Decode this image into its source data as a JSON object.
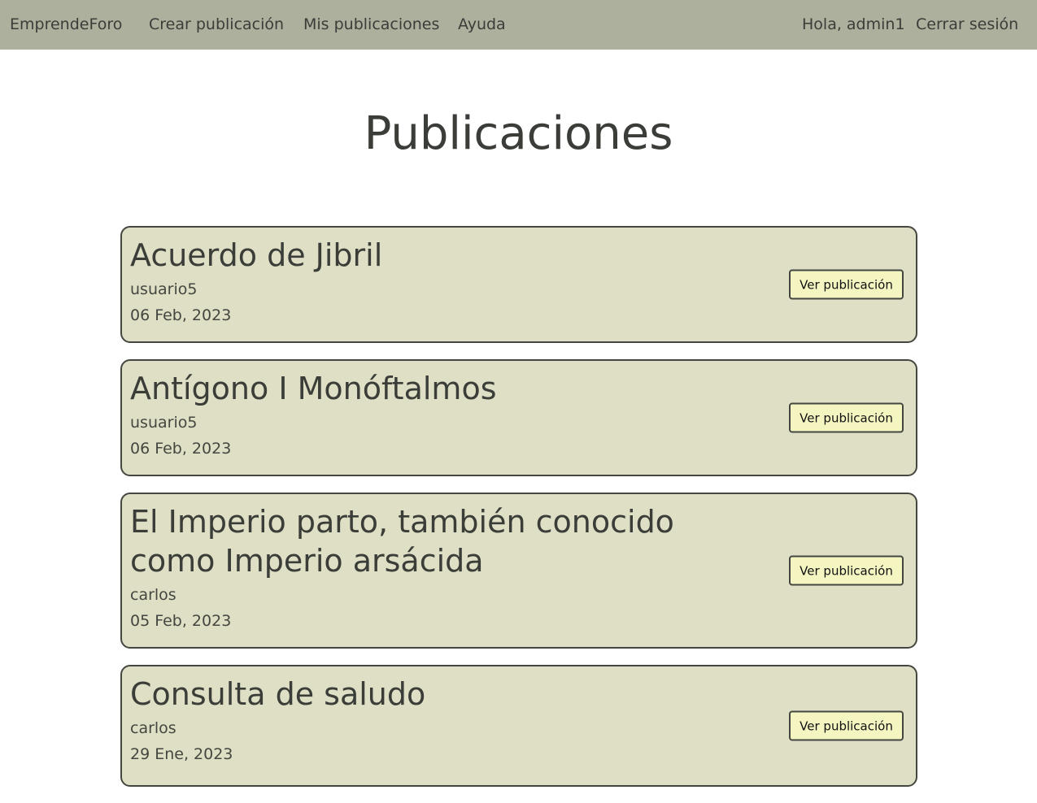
{
  "navbar": {
    "brand": "EmprendeForo",
    "links": [
      "Crear publicación",
      "Mis publicaciones",
      "Ayuda"
    ],
    "greeting": "Hola, admin1",
    "logout": "Cerrar sesión"
  },
  "page": {
    "title": "Publicaciones"
  },
  "posts": [
    {
      "title": "Acuerdo de Jibril",
      "author": "usuario5",
      "date": "06 Feb, 2023",
      "button": "Ver publicación"
    },
    {
      "title": "Antígono I Monóftalmos",
      "author": "usuario5",
      "date": "06 Feb, 2023",
      "button": "Ver publicación"
    },
    {
      "title": "El Imperio parto, también conocido como Imperio arsácida",
      "author": "carlos",
      "date": "05 Feb, 2023",
      "button": "Ver publicación"
    },
    {
      "title": "Consulta de saludo",
      "author": "carlos",
      "date": "29 Ene, 2023",
      "button": "Ver publicación"
    }
  ]
}
